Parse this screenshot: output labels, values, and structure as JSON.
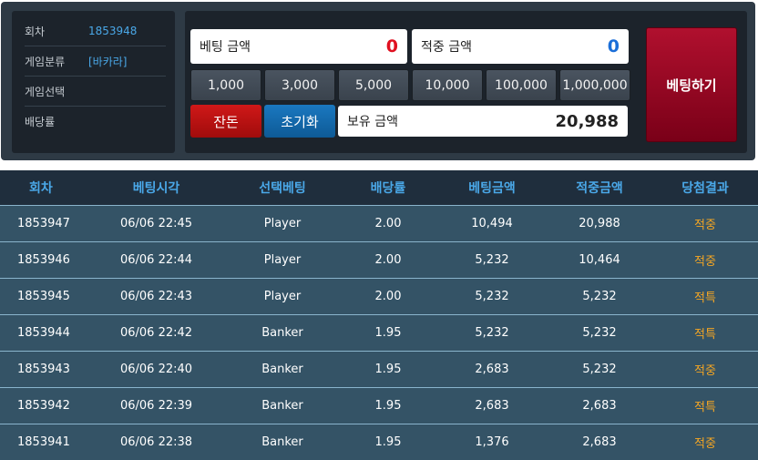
{
  "info": {
    "round_label": "회차",
    "round_value": "1853948",
    "category_label": "게임분류",
    "category_value": "[바카라]",
    "selection_label": "게임선택",
    "selection_value": "",
    "odds_label": "배당률",
    "odds_value": ""
  },
  "bet_amount": {
    "label": "베팅 금액",
    "value": "0"
  },
  "win_amount": {
    "label": "적중 금액",
    "value": "0"
  },
  "chips": [
    "1,000",
    "3,000",
    "5,000",
    "10,000",
    "100,000",
    "1,000,000"
  ],
  "change_label": "잔돈",
  "reset_label": "초기화",
  "balance": {
    "label": "보유 금액",
    "value": "20,988"
  },
  "bet_button_label": "베팅하기",
  "colors": {
    "bet_value": "#e01020",
    "win_value": "#1a6ed8",
    "result": "#f5a623"
  },
  "history": {
    "headers": [
      "회차",
      "베팅시각",
      "선택베팅",
      "배당률",
      "베팅금액",
      "적중금액",
      "당첨결과"
    ],
    "rows": [
      [
        "1853947",
        "06/06 22:45",
        "Player",
        "2.00",
        "10,494",
        "20,988",
        "적중"
      ],
      [
        "1853946",
        "06/06 22:44",
        "Player",
        "2.00",
        "5,232",
        "10,464",
        "적중"
      ],
      [
        "1853945",
        "06/06 22:43",
        "Player",
        "2.00",
        "5,232",
        "5,232",
        "적특"
      ],
      [
        "1853944",
        "06/06 22:42",
        "Banker",
        "1.95",
        "5,232",
        "5,232",
        "적특"
      ],
      [
        "1853943",
        "06/06 22:40",
        "Banker",
        "1.95",
        "2,683",
        "5,232",
        "적중"
      ],
      [
        "1853942",
        "06/06 22:39",
        "Banker",
        "1.95",
        "2,683",
        "2,683",
        "적특"
      ],
      [
        "1853941",
        "06/06 22:38",
        "Banker",
        "1.95",
        "1,376",
        "2,683",
        "적중"
      ]
    ]
  }
}
